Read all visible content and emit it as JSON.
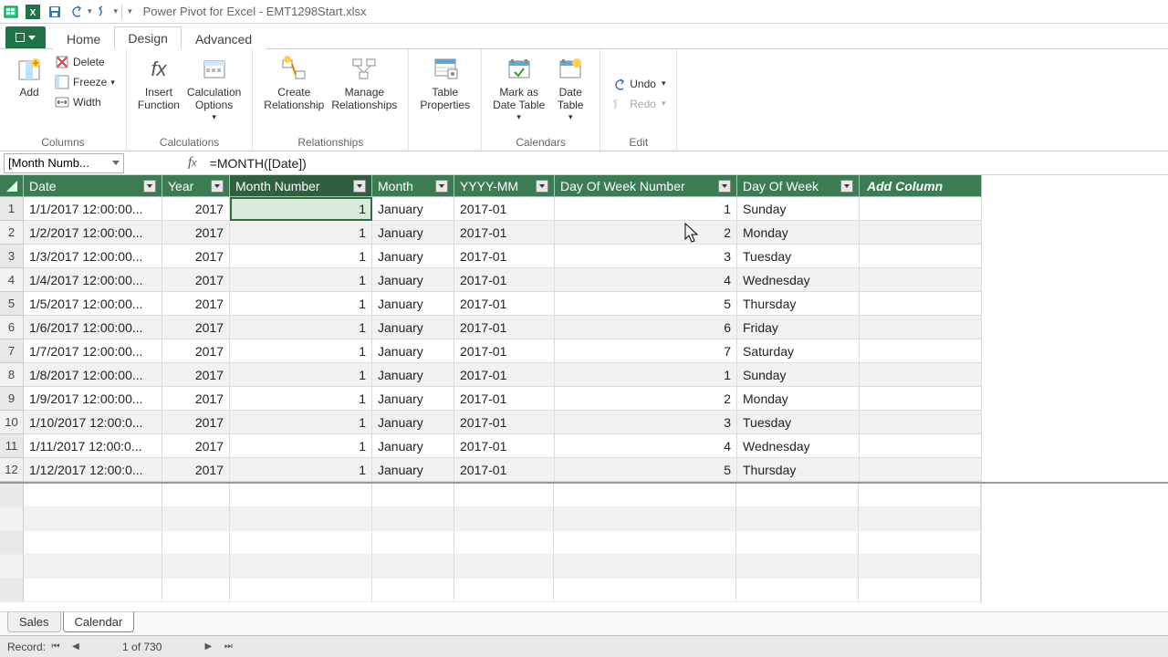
{
  "title": "Power Pivot for Excel - EMT1298Start.xlsx",
  "tabs": {
    "home": "Home",
    "design": "Design",
    "advanced": "Advanced"
  },
  "ribbon": {
    "columns": {
      "add": "Add",
      "delete": "Delete",
      "freeze": "Freeze",
      "width": "Width",
      "group": "Columns"
    },
    "calculations": {
      "insert_fn": "Insert\nFunction",
      "calc_opts": "Calculation\nOptions",
      "group": "Calculations"
    },
    "relationships": {
      "create": "Create\nRelationship",
      "manage": "Manage\nRelationships",
      "group": "Relationships"
    },
    "table": {
      "props": "Table\nProperties"
    },
    "calendars": {
      "mark": "Mark as\nDate Table",
      "date_tbl": "Date\nTable",
      "group": "Calendars"
    },
    "edit": {
      "undo": "Undo",
      "redo": "Redo",
      "group": "Edit"
    }
  },
  "name_box": "[Month Numb...",
  "formula": "=MONTH([Date])",
  "columns": {
    "date": "Date",
    "year": "Year",
    "month_number": "Month Number",
    "month": "Month",
    "yyyy_mm": "YYYY-MM",
    "dow_num": "Day Of Week Number",
    "dow": "Day Of Week",
    "add": "Add Column"
  },
  "rows": [
    {
      "n": "1",
      "date": "1/1/2017 12:00:00...",
      "year": "2017",
      "mnum": "1",
      "month": "January",
      "ym": "2017-01",
      "downum": "1",
      "dow": "Sunday"
    },
    {
      "n": "2",
      "date": "1/2/2017 12:00:00...",
      "year": "2017",
      "mnum": "1",
      "month": "January",
      "ym": "2017-01",
      "downum": "2",
      "dow": "Monday"
    },
    {
      "n": "3",
      "date": "1/3/2017 12:00:00...",
      "year": "2017",
      "mnum": "1",
      "month": "January",
      "ym": "2017-01",
      "downum": "3",
      "dow": "Tuesday"
    },
    {
      "n": "4",
      "date": "1/4/2017 12:00:00...",
      "year": "2017",
      "mnum": "1",
      "month": "January",
      "ym": "2017-01",
      "downum": "4",
      "dow": "Wednesday"
    },
    {
      "n": "5",
      "date": "1/5/2017 12:00:00...",
      "year": "2017",
      "mnum": "1",
      "month": "January",
      "ym": "2017-01",
      "downum": "5",
      "dow": "Thursday"
    },
    {
      "n": "6",
      "date": "1/6/2017 12:00:00...",
      "year": "2017",
      "mnum": "1",
      "month": "January",
      "ym": "2017-01",
      "downum": "6",
      "dow": "Friday"
    },
    {
      "n": "7",
      "date": "1/7/2017 12:00:00...",
      "year": "2017",
      "mnum": "1",
      "month": "January",
      "ym": "2017-01",
      "downum": "7",
      "dow": "Saturday"
    },
    {
      "n": "8",
      "date": "1/8/2017 12:00:00...",
      "year": "2017",
      "mnum": "1",
      "month": "January",
      "ym": "2017-01",
      "downum": "1",
      "dow": "Sunday"
    },
    {
      "n": "9",
      "date": "1/9/2017 12:00:00...",
      "year": "2017",
      "mnum": "1",
      "month": "January",
      "ym": "2017-01",
      "downum": "2",
      "dow": "Monday"
    },
    {
      "n": "10",
      "date": "1/10/2017 12:00:0...",
      "year": "2017",
      "mnum": "1",
      "month": "January",
      "ym": "2017-01",
      "downum": "3",
      "dow": "Tuesday"
    },
    {
      "n": "11",
      "date": "1/11/2017 12:00:0...",
      "year": "2017",
      "mnum": "1",
      "month": "January",
      "ym": "2017-01",
      "downum": "4",
      "dow": "Wednesday"
    },
    {
      "n": "12",
      "date": "1/12/2017 12:00:0...",
      "year": "2017",
      "mnum": "1",
      "month": "January",
      "ym": "2017-01",
      "downum": "5",
      "dow": "Thursday"
    }
  ],
  "sheets": {
    "sales": "Sales",
    "calendar": "Calendar"
  },
  "status": {
    "record": "Record:",
    "count": "1 of 730"
  }
}
